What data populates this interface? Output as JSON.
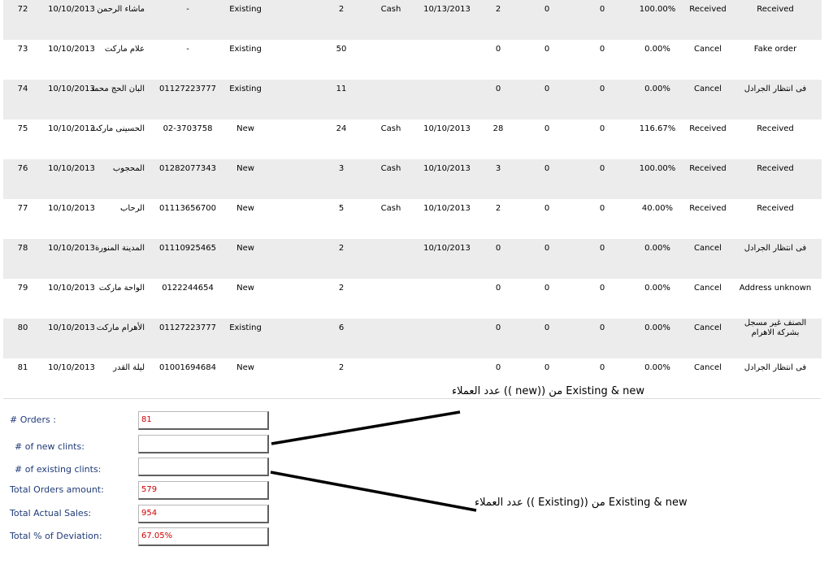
{
  "rows": [
    {
      "num": "72",
      "date": "10/10/2013",
      "name": "ماشاء الرحمن",
      "phone": "-",
      "type": "Existing",
      "qty": "2",
      "pay": "Cash",
      "deliv_date": "10/13/2013",
      "actual": "2",
      "z1": "0",
      "z2": "0",
      "pct": "100.00%",
      "status": "Received",
      "note": "Received"
    },
    {
      "num": "73",
      "date": "10/10/2013",
      "name": "علام ماركت",
      "phone": "-",
      "type": "Existing",
      "qty": "50",
      "pay": "",
      "deliv_date": "",
      "actual": "0",
      "z1": "0",
      "z2": "0",
      "pct": "0.00%",
      "status": "Cancel",
      "note": "Fake order"
    },
    {
      "num": "74",
      "date": "10/10/2013",
      "name": "البان الحج محمد",
      "phone": "01127223777",
      "type": "Existing",
      "qty": "11",
      "pay": "",
      "deliv_date": "",
      "actual": "0",
      "z1": "0",
      "z2": "0",
      "pct": "0.00%",
      "status": "Cancel",
      "note": "فى انتظار الجرادل"
    },
    {
      "num": "75",
      "date": "10/10/2013",
      "name": "الحسينى ماركت",
      "phone": "02-3703758",
      "type": "New",
      "qty": "24",
      "pay": "Cash",
      "deliv_date": "10/10/2013",
      "actual": "28",
      "z1": "0",
      "z2": "0",
      "pct": "116.67%",
      "status": "Received",
      "note": "Received"
    },
    {
      "num": "76",
      "date": "10/10/2013",
      "name": "المحجوب",
      "phone": "01282077343",
      "type": "New",
      "qty": "3",
      "pay": "Cash",
      "deliv_date": "10/10/2013",
      "actual": "3",
      "z1": "0",
      "z2": "0",
      "pct": "100.00%",
      "status": "Received",
      "note": "Received"
    },
    {
      "num": "77",
      "date": "10/10/2013",
      "name": "الرحاب",
      "phone": "01113656700",
      "type": "New",
      "qty": "5",
      "pay": "Cash",
      "deliv_date": "10/10/2013",
      "actual": "2",
      "z1": "0",
      "z2": "0",
      "pct": "40.00%",
      "status": "Received",
      "note": "Received"
    },
    {
      "num": "78",
      "date": "10/10/2013",
      "name": "المدينة المنورة",
      "phone": "01110925465",
      "type": "New",
      "qty": "2",
      "pay": "",
      "deliv_date": "10/10/2013",
      "actual": "0",
      "z1": "0",
      "z2": "0",
      "pct": "0.00%",
      "status": "Cancel",
      "note": "فى انتظار الجرادل"
    },
    {
      "num": "79",
      "date": "10/10/2013",
      "name": "الواحة ماركت",
      "phone": "0122244654",
      "type": "New",
      "qty": "2",
      "pay": "",
      "deliv_date": "",
      "actual": "0",
      "z1": "0",
      "z2": "0",
      "pct": "0.00%",
      "status": "Cancel",
      "note": "Address unknown"
    },
    {
      "num": "80",
      "date": "10/10/2013",
      "name": "الأهرام ماركت",
      "phone": "01127223777",
      "type": "Existing",
      "qty": "6",
      "pay": "",
      "deliv_date": "",
      "actual": "0",
      "z1": "0",
      "z2": "0",
      "pct": "0.00%",
      "status": "Cancel",
      "note": "الصنف غير مسجل بشركة الاهرام"
    },
    {
      "num": "81",
      "date": "10/10/2013",
      "name": "ليلة القدر",
      "phone": "01001694684",
      "type": "New",
      "qty": "2",
      "pay": "",
      "deliv_date": "",
      "actual": "0",
      "z1": "0",
      "z2": "0",
      "pct": "0.00%",
      "status": "Cancel",
      "note": "فى انتظار الجرادل"
    }
  ],
  "summary": {
    "orders_label": "# Orders :",
    "orders_value": "81",
    "new_clients_label": "# of new clints:",
    "new_clients_value": "",
    "existing_clients_label": "# of existing clints:",
    "existing_clients_value": "",
    "total_orders_label": "Total Orders amount:",
    "total_orders_value": "579",
    "actual_sales_label": "Total Actual Sales:",
    "actual_sales_value": "954",
    "deviation_label": "Total % of Deviation:",
    "deviation_value": "67.05%"
  },
  "annotations": {
    "new_note": "عدد العملاء (( new)) من Existing & new",
    "existing_note": "عدد العملاء ((  Existing)) من Existing & new"
  },
  "colors": {
    "row_shade": "#ececec",
    "label_blue": "#1f3a78",
    "value_red": "#cc0000"
  }
}
